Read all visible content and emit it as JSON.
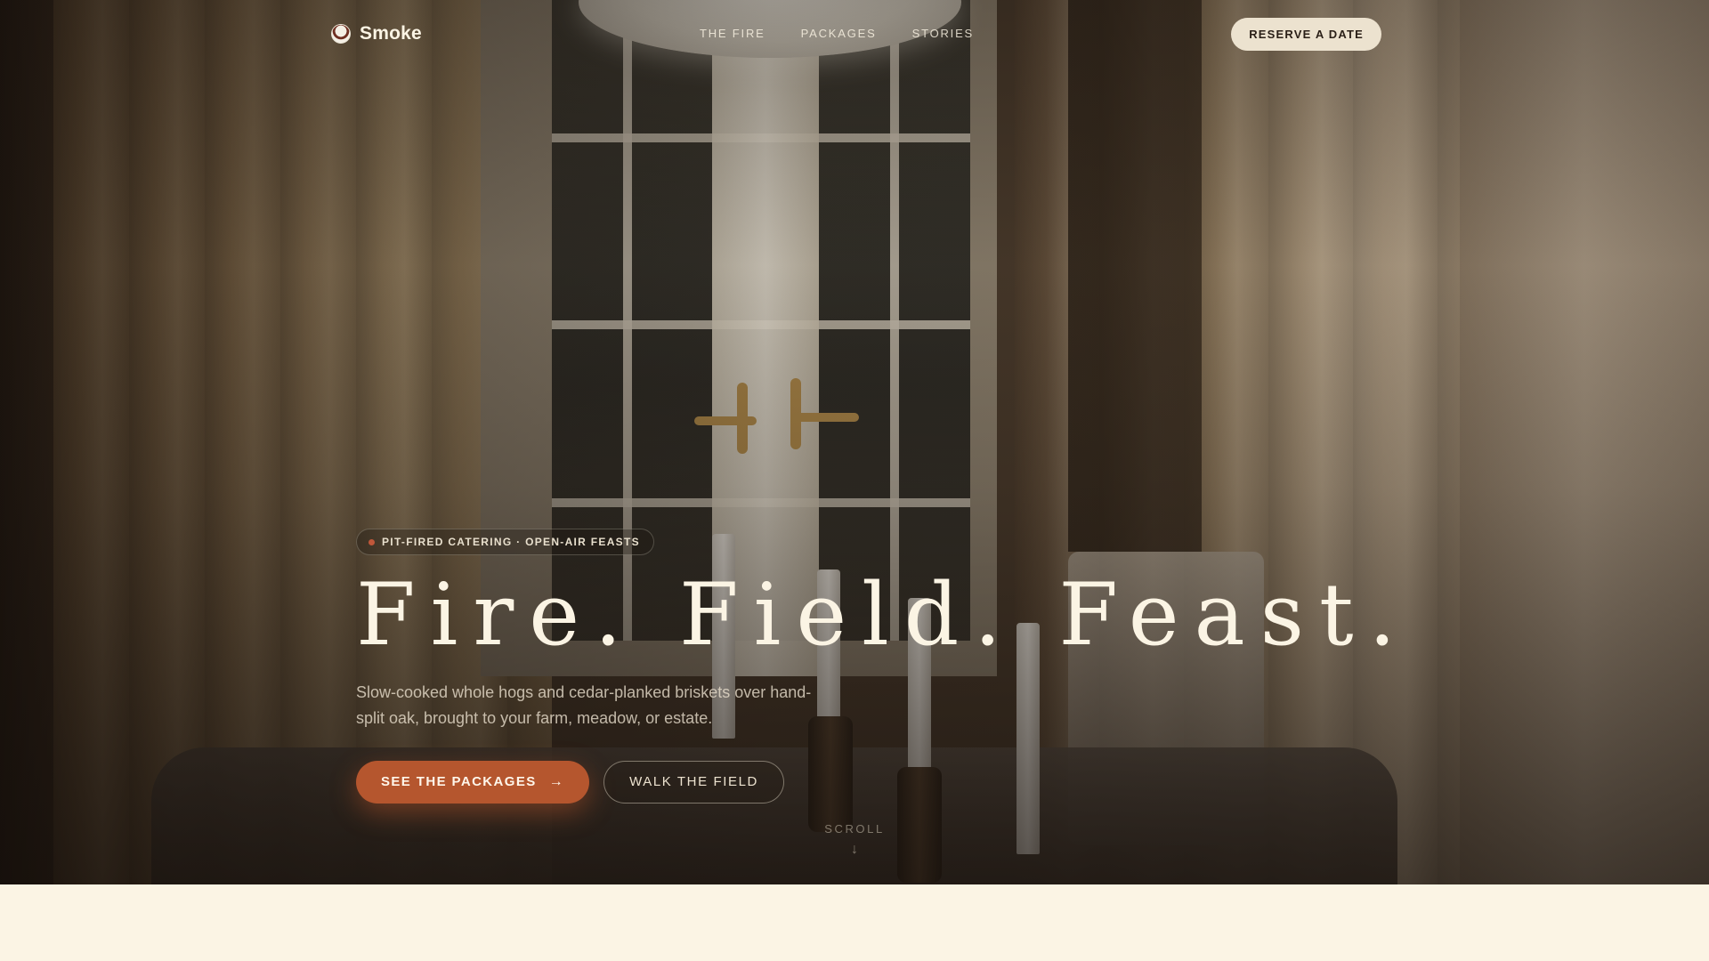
{
  "nav": {
    "brand_name": "Smoke",
    "brand_icon": "smoke-logo-icon",
    "links": [
      {
        "label": "THE FIRE"
      },
      {
        "label": "PACKAGES"
      },
      {
        "label": "STORIES"
      }
    ],
    "reserve_label": "RESERVE A DATE"
  },
  "hero": {
    "eyebrow": "PIT-FIRED CATERING · OPEN-AIR FEASTS",
    "headline": "Fire. Field. Feast.",
    "subcopy": "Slow-cooked whole hogs and cedar-planked briskets over hand-split oak, brought to your farm, meadow, or estate.",
    "primary_cta": "SEE THE PACKAGES",
    "primary_cta_icon": "arrow-right-icon",
    "secondary_cta": "WALK THE FIELD",
    "scroll_label": "SCROLL",
    "scroll_icon": "arrow-down-icon"
  },
  "colors": {
    "accent": "#b5562e",
    "cream": "#fbf4e4",
    "reserve_bg": "#ece2cf",
    "dot": "#c0573a"
  }
}
